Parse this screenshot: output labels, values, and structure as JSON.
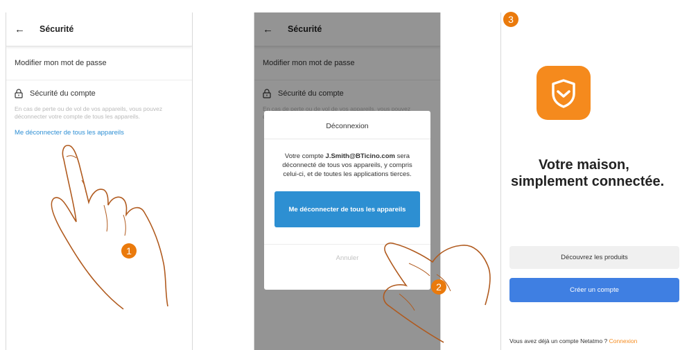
{
  "screen1": {
    "header_title": "Sécurité",
    "change_password": "Modifier mon mot de passe",
    "account_security_title": "Sécurité du compte",
    "account_security_desc": "En cas de perte ou de vol de vos appareils, vous pouvez déconnecter votre compte de tous les appareils.",
    "logout_all_link": "Me déconnecter de tous les appareils",
    "step_number": "1"
  },
  "screen2": {
    "header_title": "Sécurité",
    "change_password": "Modifier mon mot de passe",
    "account_security_title": "Sécurité du compte",
    "account_security_desc": "En cas de perte ou de vol de vos appareils, vous pouvez déconnecter votre compte de tous les appareils.",
    "dialog": {
      "title": "Déconnexion",
      "body_prefix": "Votre compte ",
      "email": "J.Smith@BTicino.com",
      "body_suffix": " sera déconnecté de tous vos appareils, y compris celui-ci, et de toutes les applications tierces.",
      "confirm_button": "Me déconnecter de tous les appareils",
      "cancel_button": "Annuler"
    },
    "step_number": "2"
  },
  "screen3": {
    "tagline_line1": "Votre maison,",
    "tagline_line2": "simplement connectée.",
    "discover_button": "Découvrez les produits",
    "create_account_button": "Créer un compte",
    "footer_text": "Vous avez déjà un compte Netatmo ? ",
    "footer_link": "Connexion",
    "step_number": "3"
  },
  "colors": {
    "accent_orange": "#f58a1d",
    "link_blue": "#2e8fd4",
    "button_blue": "#3f7fe2",
    "badge_orange": "#ea7a0c"
  }
}
